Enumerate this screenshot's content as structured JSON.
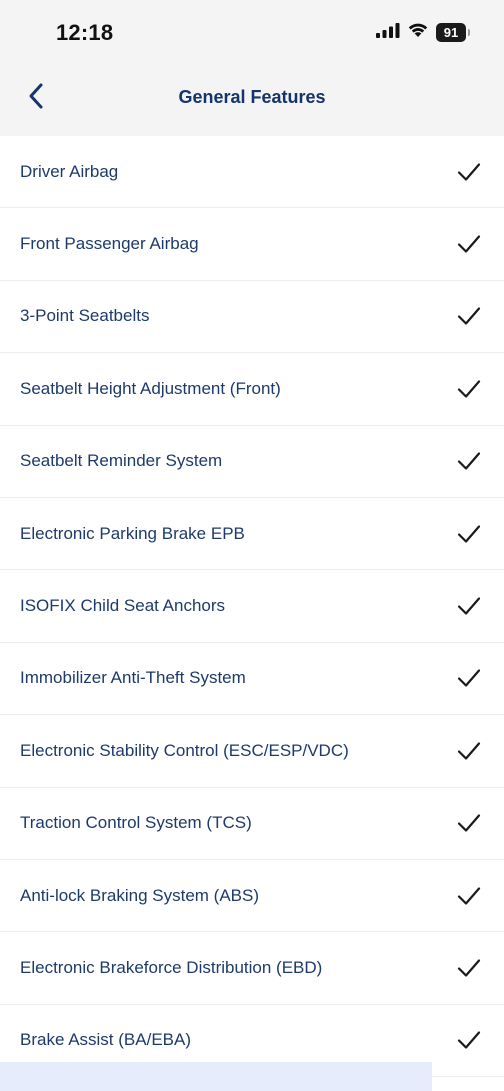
{
  "status": {
    "time": "12:18",
    "battery": "91"
  },
  "header": {
    "title": "General Features"
  },
  "features": [
    {
      "label": "Driver Airbag",
      "checked": true
    },
    {
      "label": "Front Passenger Airbag",
      "checked": true
    },
    {
      "label": "3-Point Seatbelts",
      "checked": true
    },
    {
      "label": "Seatbelt Height Adjustment (Front)",
      "checked": true
    },
    {
      "label": "Seatbelt Reminder System",
      "checked": true
    },
    {
      "label": "Electronic Parking Brake EPB",
      "checked": true
    },
    {
      "label": "ISOFIX Child Seat Anchors",
      "checked": true
    },
    {
      "label": "Immobilizer Anti-Theft System",
      "checked": true
    },
    {
      "label": "Electronic Stability Control (ESC/ESP/VDC)",
      "checked": true
    },
    {
      "label": "Traction Control System (TCS)",
      "checked": true
    },
    {
      "label": "Anti-lock Braking System (ABS)",
      "checked": true
    },
    {
      "label": "Electronic Brakeforce Distribution (EBD)",
      "checked": true
    },
    {
      "label": "Brake Assist (BA/EBA)",
      "checked": true
    }
  ],
  "colors": {
    "accent": "#14356b",
    "header_bg": "#f4f4f5",
    "check": "#1a1a1a"
  },
  "icons": {
    "back": "chevron-left-icon",
    "check": "checkmark-icon",
    "signal": "cellular-signal-icon",
    "wifi": "wifi-icon",
    "battery": "battery-icon"
  }
}
